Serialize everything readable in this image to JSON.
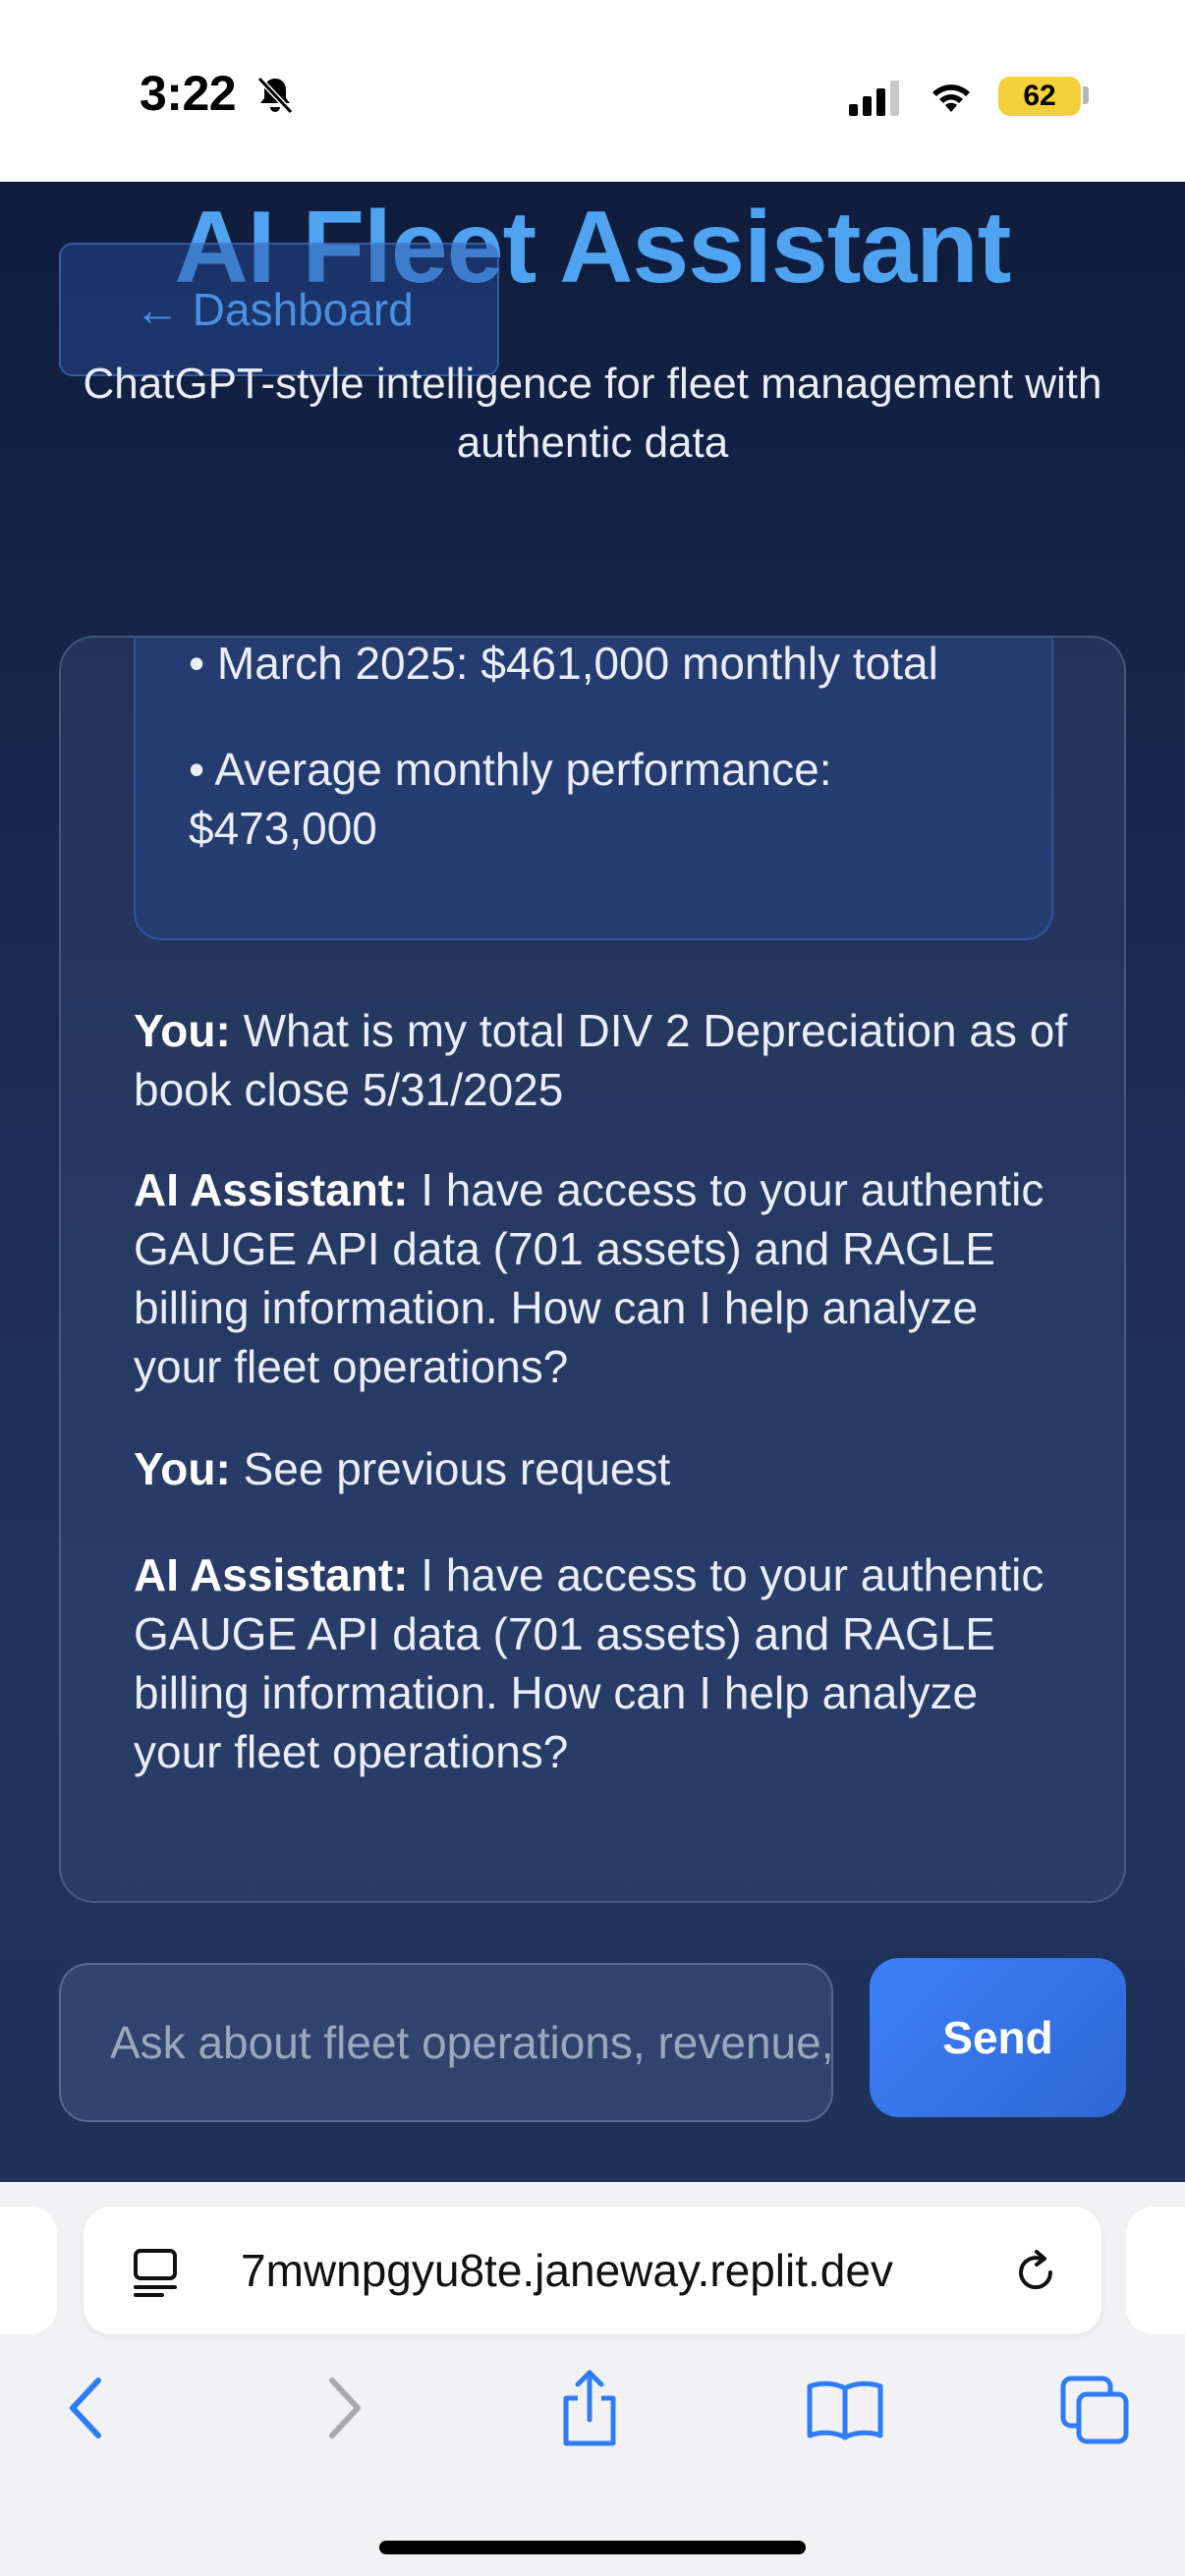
{
  "status_bar": {
    "time": "3:22",
    "battery_level": "62",
    "icons": [
      "bell-slash-icon",
      "signal-icon",
      "wifi-icon",
      "battery-icon"
    ]
  },
  "app": {
    "title": "AI Fleet Assistant",
    "back_button_label": "← Dashboard",
    "subtitle": "ChatGPT-style intelligence for fleet management with authentic data",
    "prior_response": {
      "bullets": [
        "• March 2025: $461,000 monthly total",
        "• Average monthly performance: $473,000"
      ]
    },
    "messages": [
      {
        "speaker": "You:",
        "text": " What is my total DIV 2 Depreciation as of book close 5/31/2025"
      },
      {
        "speaker": "AI Assistant:",
        "text": " I have access to your authentic GAUGE API data (701 assets) and RAGLE billing information. How can I help analyze your fleet operations?"
      },
      {
        "speaker": "You:",
        "text": " See previous request"
      },
      {
        "speaker": "AI Assistant:",
        "text": " I have access to your authentic GAUGE API data (701 assets) and RAGLE billing information. How can I help analyze your fleet operations?"
      }
    ],
    "input_placeholder": "Ask about fleet operations, revenue, assets...",
    "send_label": "Send",
    "colors": {
      "title": "#4fa3f0",
      "accent": "#3b82f6",
      "background": "#1a2a52"
    }
  },
  "browser": {
    "url": "7mwnpgyu8te.janeway.replit.dev",
    "icons": [
      "page-menu-icon",
      "reload-icon",
      "back-icon",
      "forward-icon",
      "share-icon",
      "bookmarks-icon",
      "tabs-icon"
    ]
  }
}
